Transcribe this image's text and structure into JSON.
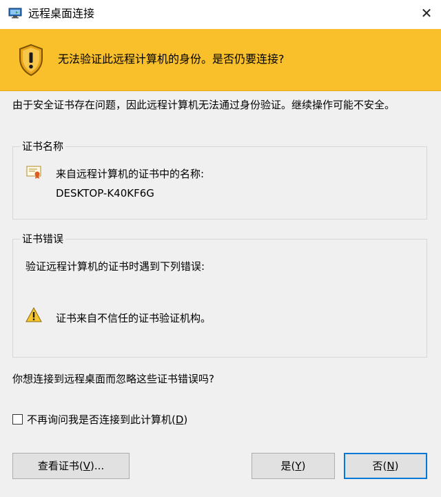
{
  "window": {
    "title": "远程桌面连接",
    "close_glyph": "✕"
  },
  "banner": {
    "message": "无法验证此远程计算机的身份。是否仍要连接?"
  },
  "description": "由于安全证书存在问题，因此远程计算机无法通过身份验证。继续操作可能不安全。",
  "cert_name_group": {
    "legend": "证书名称",
    "label": "来自远程计算机的证书中的名称:",
    "name": "DESKTOP-K40KF6G"
  },
  "cert_error_group": {
    "legend": "证书错误",
    "intro": "验证远程计算机的证书时遇到下列错误:",
    "error": "证书来自不信任的证书验证机构。"
  },
  "question": "你想连接到远程桌面而忽略这些证书错误吗?",
  "checkbox": {
    "label_before": "不再询问我是否连接到此计算机(",
    "accel": "D",
    "label_after": ")",
    "checked": false
  },
  "buttons": {
    "view_cert": {
      "before": "查看证书(",
      "accel": "V",
      "after": ")..."
    },
    "yes": {
      "before": "是(",
      "accel": "Y",
      "after": ")"
    },
    "no": {
      "before": "否(",
      "accel": "N",
      "after": ")"
    }
  },
  "colors": {
    "banner": "#f9c02c",
    "default_button_border": "#0078d7",
    "dialog_bg": "#f0f0f0"
  },
  "icons": {
    "app": "remote-desktop-icon",
    "banner": "security-shield-warning-icon",
    "certificate": "certificate-icon",
    "warning": "warning-triangle-icon",
    "close": "close-icon"
  }
}
